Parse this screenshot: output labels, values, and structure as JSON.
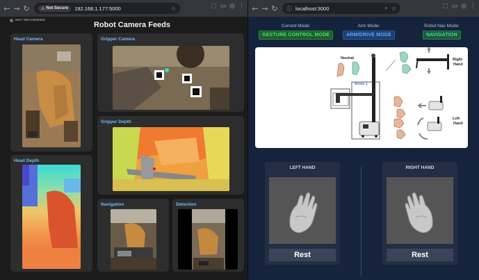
{
  "left_window": {
    "address": "192.168.1.177:5000",
    "security_label": "Not Secure",
    "recording_status": "NOT RECORDING",
    "page_title": "Robot Camera Feeds",
    "panels": {
      "head_camera": "Head Camera",
      "head_depth": "Head Depth",
      "gripper_camera": "Gripper Camera",
      "gripper_depth": "Gripper Depth",
      "navigation": "Navigation",
      "detection": "Detection"
    }
  },
  "right_window": {
    "address": "localhost:3000",
    "modes": [
      {
        "label": "Current Mode:",
        "value": "GESTURE CONTROL MODE"
      },
      {
        "label": "Arm Mode:",
        "value": "ARM/DRIVE MODE"
      },
      {
        "label": "Robot Nav Mode:",
        "value": "NAVIGATION"
      }
    ],
    "diagram": {
      "neutral_label": "Neutral",
      "mode1_label": "Mode 1",
      "right_hand_label_1": "Right",
      "right_hand_label_2": "Hand",
      "left_hand_label_1": "Left",
      "left_hand_label_2": "Hand"
    },
    "hands": [
      {
        "title": "LEFT HAND",
        "state": "Rest"
      },
      {
        "title": "RIGHT HAND",
        "state": "Rest"
      }
    ]
  },
  "icons": [
    "back-arrow-icon",
    "forward-arrow-icon",
    "reload-icon",
    "warning-icon",
    "star-icon",
    "extensions-icon",
    "profile-icon",
    "menu-dots-icon",
    "search-icon",
    "page-info-icon"
  ],
  "colors": {
    "panel_label": "#72b8f5",
    "current_mode": "#48e070",
    "arm_mode": "#63a8f5",
    "nav_mode": "#46d99a"
  }
}
